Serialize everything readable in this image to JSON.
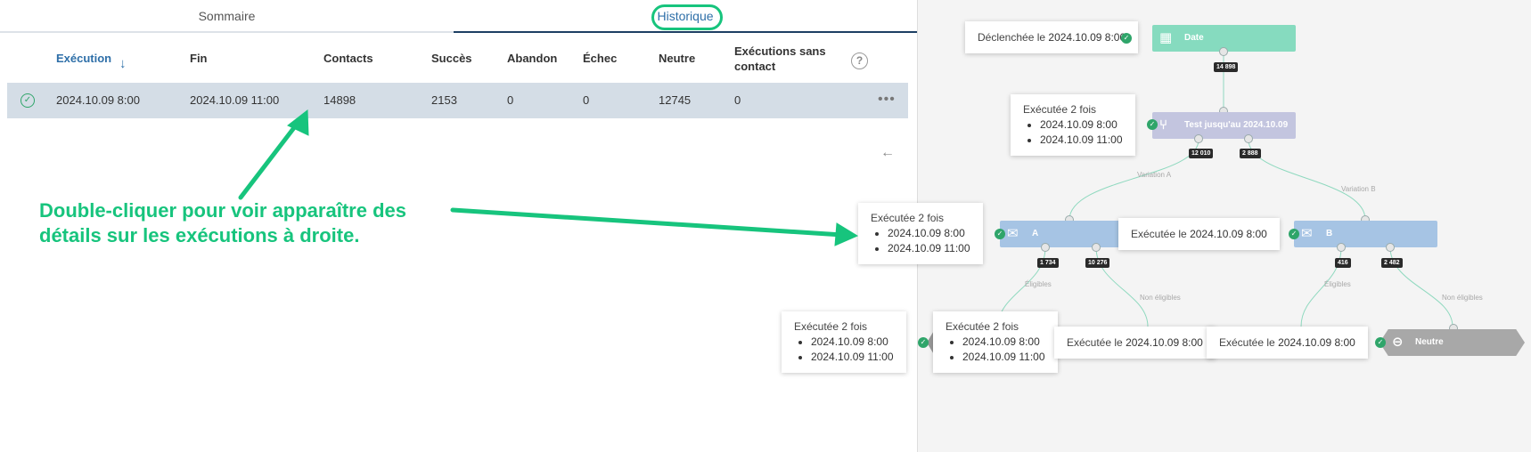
{
  "tabs": {
    "sommaire": "Sommaire",
    "historique": "Historique"
  },
  "table": {
    "headers": {
      "execution": "Exécution",
      "fin": "Fin",
      "contacts": "Contacts",
      "succes": "Succès",
      "abandon": "Abandon",
      "echec": "Échec",
      "neutre": "Neutre",
      "sans_contact_1": "Exécutions sans",
      "sans_contact_2": "contact",
      "help": "?"
    },
    "sort_icon": "↓",
    "row": {
      "status_icon": "✓",
      "execution": "2024.10.09 8:00",
      "fin": "2024.10.09 11:00",
      "contacts": "14898",
      "succes": "2153",
      "abandon": "0",
      "echec": "0",
      "neutre": "12745",
      "sans_contact": "0",
      "more": "•••"
    }
  },
  "back_icon": "←",
  "annotation": {
    "line1": "Double-cliquer pour voir apparaître des",
    "line2": "détails sur les exécutions à droite."
  },
  "workflow": {
    "nodes": {
      "date": "Date",
      "test": "Test jusqu'au 2024.10.09",
      "a": "A",
      "b": "B",
      "neutre": "Neutre"
    },
    "counts": {
      "date_out": "14 898",
      "test_left": "12 010",
      "test_right": "2 888",
      "a_left": "1 734",
      "a_right": "10 276",
      "b_left": "416",
      "b_right": "2 482"
    },
    "edge_labels": {
      "variation_a": "Variation A",
      "variation_b": "Variation B",
      "eligibles_a": "Éligibles",
      "non_eligibles_a": "Non éligibles",
      "eligibles_b": "Éligibles",
      "non_eligibles_b": "Non éligibles"
    },
    "tooltips": {
      "date": {
        "prefix": "Déclenchée le",
        "value": "2024.10.09 8:00"
      },
      "test": {
        "title": "Exécutée 2 fois",
        "items": [
          "2024.10.09 8:00",
          "2024.10.09 11:00"
        ]
      },
      "a": {
        "title": "Exécutée 2 fois",
        "items": [
          "2024.10.09 8:00",
          "2024.10.09 11:00"
        ]
      },
      "b": {
        "prefix": "Exécutée le",
        "value": "2024.10.09 8:00"
      },
      "bottom1": {
        "title": "Exécutée 2 fois",
        "items": [
          "2024.10.09 8:00",
          "2024.10.09 11:00"
        ]
      },
      "bottom2": {
        "title": "Exécutée 2 fois",
        "items": [
          "2024.10.09 8:00",
          "2024.10.09 11:00"
        ]
      },
      "bottom3": {
        "prefix": "Exécutée le",
        "value": "2024.10.09 8:00"
      },
      "bottom4": {
        "prefix": "Exécutée le",
        "value": "2024.10.09 8:00"
      }
    }
  },
  "colors": {
    "accent": "#17c47d",
    "link": "#2e6fa8",
    "row_highlight": "#d4dde6",
    "success": "#2fa56a"
  }
}
